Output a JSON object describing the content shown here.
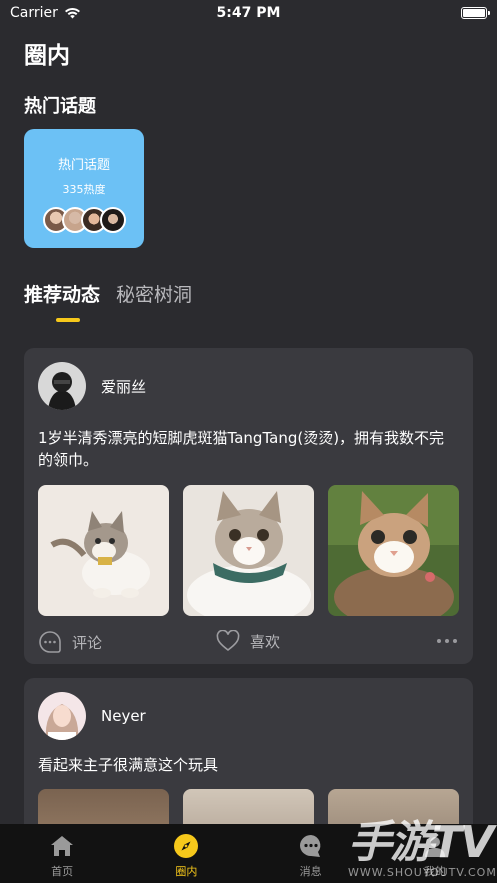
{
  "status_bar": {
    "carrier": "Carrier",
    "time": "5:47 PM",
    "battery_level": 1.0
  },
  "page": {
    "title": "圈内"
  },
  "hot_topics": {
    "section_title": "热门话题",
    "card": {
      "title": "热门话题",
      "heat": "335热度",
      "color": "#6cc1f5"
    }
  },
  "feed_tabs": [
    {
      "label": "推荐动态",
      "active": true
    },
    {
      "label": "秘密树洞",
      "active": false
    }
  ],
  "posts": [
    {
      "username": "爱丽丝",
      "text": "1岁半清秀漂亮的短脚虎斑猫TangTang(烫烫)，拥有我数不完的领巾。",
      "comment_label": "评论",
      "like_label": "喜欢"
    },
    {
      "username": "Neyer",
      "text": "看起来主子很满意这个玩具"
    }
  ],
  "tab_bar": [
    {
      "label": "首页",
      "icon": "home-icon",
      "active": false
    },
    {
      "label": "圈内",
      "icon": "compass-icon",
      "active": true
    },
    {
      "label": "消息",
      "icon": "chat-bubble-icon",
      "active": false
    },
    {
      "label": "我的",
      "icon": "profile-icon",
      "active": false
    }
  ],
  "watermark": {
    "brand": "手游TV",
    "url": "WWW.SHOUYOUTV.COM"
  },
  "colors": {
    "accent": "#f6c81b",
    "background": "#2b2b2f",
    "card": "#3a3a3f",
    "tab_bar": "#121212"
  }
}
